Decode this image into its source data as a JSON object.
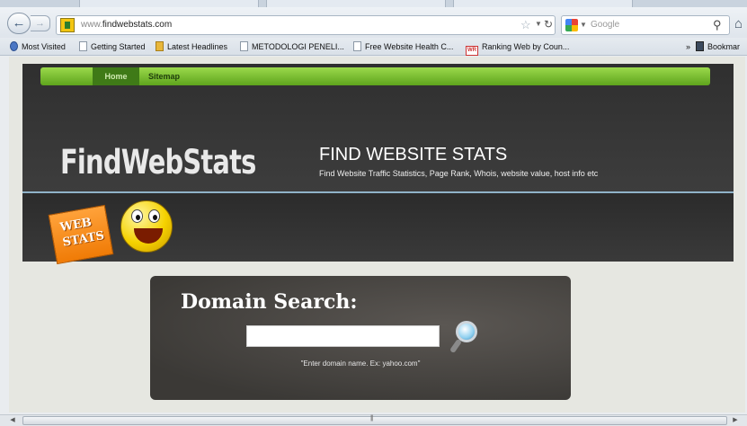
{
  "browser": {
    "url_domain": "findwebstats.com",
    "url_prefix": "www.",
    "search_placeholder": "Google",
    "bookmarks": [
      {
        "label": "Most Visited",
        "icon": "globe-icon"
      },
      {
        "label": "Getting Started",
        "icon": "page-icon"
      },
      {
        "label": "Latest Headlines",
        "icon": "rss-folder-icon"
      },
      {
        "label": "METODOLOGI PENELI...",
        "icon": "page-icon"
      },
      {
        "label": "Free Website Health C...",
        "icon": "page-icon"
      },
      {
        "label": "Ranking Web by Coun...",
        "icon": "wr-icon"
      },
      {
        "label": "Bookmar",
        "icon": "bookmarks-icon"
      }
    ],
    "overflow_chevron": "»",
    "scroll_grip": "|||"
  },
  "site": {
    "nav": {
      "home": "Home",
      "sitemap": "Sitemap"
    },
    "logo": "FindWebStats",
    "title": "FIND WEBSITE STATS",
    "subtitle": "Find Website Traffic Statistics, Page Rank, Whois, website value, host info etc",
    "badge_lines": [
      "WEB",
      "STATS"
    ]
  },
  "search": {
    "heading": "Domain Search:",
    "input_value": "",
    "hint": "\"Enter domain name. Ex: yahoo.com\""
  },
  "colors": {
    "nav_green": "#6fb52a",
    "header_dark": "#333333",
    "search_panel": "#4a4745",
    "page_bg": "#e6e7e1"
  }
}
